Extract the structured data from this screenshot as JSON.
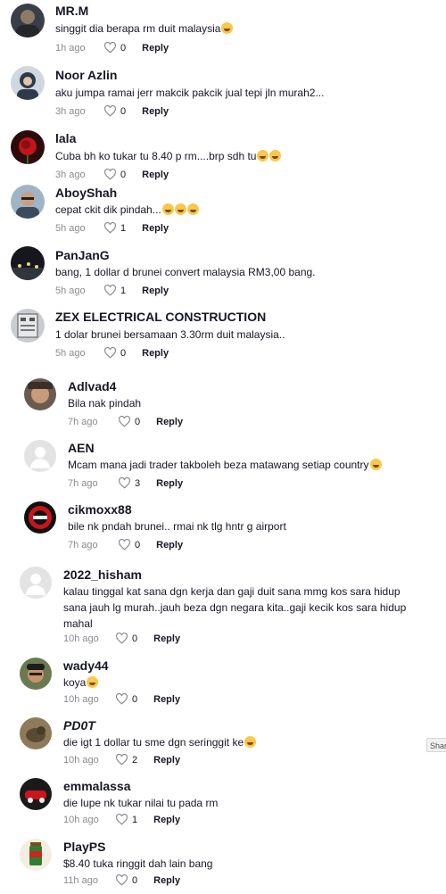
{
  "reply_label": "Reply",
  "share_tip": "Shar",
  "comments": [
    {
      "name": "MR.M",
      "text": "singgit dia berapa rm duit malaysia",
      "emoji": 1,
      "time": "1h ago",
      "likes": "0",
      "avatar": "photo-person-dark"
    },
    {
      "name": "Noor Azlin",
      "text": "aku jumpa ramai jerr makcik pakcik jual tepi jln murah2...",
      "emoji": 0,
      "time": "3h ago",
      "likes": "0",
      "avatar": "photo-woman-hijab"
    },
    {
      "name": "lala",
      "text": "Cuba bh ko tukar tu 8.40 p rm....brp sdh tu",
      "emoji": 2,
      "time": "3h ago",
      "likes": "0",
      "avatar": "photo-red-rose"
    },
    {
      "name": "AboyShah",
      "text": "cepat ckit dik pindah...",
      "emoji": 3,
      "time": "5h ago",
      "likes": "1",
      "avatar": "photo-man-glasses"
    },
    {
      "name": "PanJanG",
      "text": "bang, 1 dollar d brunei convert malaysia RM3,00 bang.",
      "emoji": 0,
      "time": "5h ago",
      "likes": "1",
      "avatar": "photo-night-city"
    },
    {
      "name": "ZEX ELECTRICAL CONSTRUCTION",
      "text": "1 dolar brunei bersamaan 3.30rm duit malaysia..",
      "emoji": 0,
      "time": "5h ago",
      "likes": "0",
      "avatar": "photo-electrical-panel"
    },
    {
      "name": "Adlvad4",
      "text": "Bila nak pindah",
      "emoji": 0,
      "time": "7h ago",
      "likes": "0",
      "avatar": "photo-person-face"
    },
    {
      "name": "AEN",
      "text": "Mcam mana jadi trader takboleh beza matawang setiap country",
      "emoji": 1,
      "time": "7h ago",
      "likes": "3",
      "avatar": "default-avatar"
    },
    {
      "name": "cikmoxx88",
      "text": "bile nk pndah brunei.. rmai nk tlg hntr g airport",
      "emoji": 0,
      "time": "7h ago",
      "likes": "0",
      "avatar": "photo-logo-red"
    },
    {
      "name": "2022_hisham",
      "text": "kalau tinggal kat sana dgn kerja dan gaji duit sana mmg kos sara hidup sana jauh lg murah..jauh beza dgn negara kita..gaji kecik kos sara hidup mahal",
      "emoji": 0,
      "time": "10h ago",
      "likes": "0",
      "avatar": "default-avatar"
    },
    {
      "name": "wady44",
      "text": "koya",
      "emoji": 1,
      "time": "10h ago",
      "likes": "0",
      "avatar": "photo-man-cap"
    },
    {
      "name": "PD0T",
      "text": "die igt 1 dollar tu sme dgn seringgit ke",
      "emoji": 1,
      "time": "10h ago",
      "likes": "2",
      "avatar": "photo-animal"
    },
    {
      "name": "emmalassa",
      "text": "die lupe nk tukar nilai tu pada rm",
      "emoji": 0,
      "time": "10h ago",
      "likes": "1",
      "avatar": "photo-car-red"
    },
    {
      "name": "PlayPS",
      "text": "$8.40 tuka ringgit dah lain bang",
      "emoji": 0,
      "time": "11h ago",
      "likes": "0",
      "avatar": "photo-milo-drink"
    }
  ],
  "colors": {
    "name": "#161823",
    "meta": "#8a8b91"
  }
}
